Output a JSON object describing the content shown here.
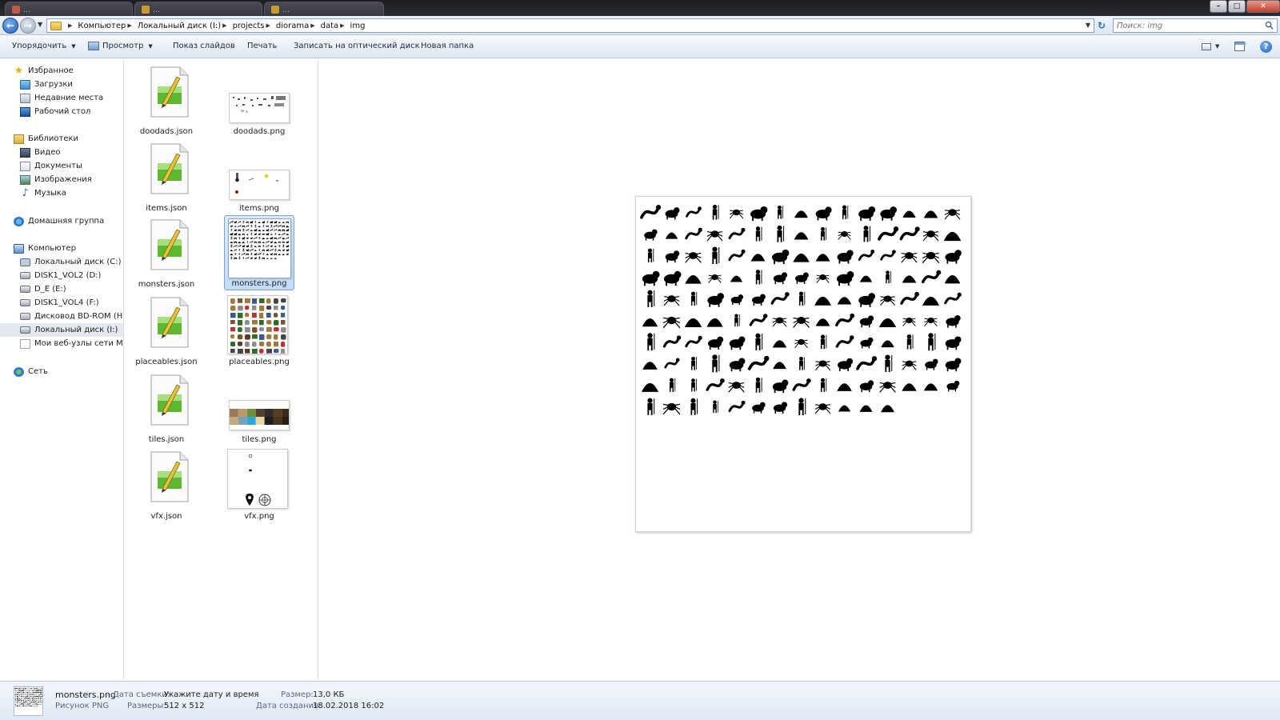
{
  "window": {
    "tabs": [
      {
        "label": "…",
        "color": "#c2574a"
      },
      {
        "label": "…",
        "color": "#c69a2e"
      },
      {
        "label": "…",
        "color": "#c69a2e"
      }
    ],
    "controls": {
      "minimize": "–",
      "maximize": "□",
      "close": "✕"
    }
  },
  "address": {
    "breadcrumbs": [
      "Компьютер",
      "Локальный диск (I:)",
      "projects",
      "diorama",
      "data",
      "img"
    ],
    "search_placeholder": "Поиск: img"
  },
  "toolbar": {
    "organize": "Упорядочить",
    "preview": "Просмотр",
    "slideshow": "Показ слайдов",
    "print": "Печать",
    "burn": "Записать на оптический диск",
    "new_folder": "Новая папка"
  },
  "nav": {
    "favorites": "Избранное",
    "downloads": "Загрузки",
    "recent": "Недавние места",
    "desktop": "Рабочий стол",
    "libraries": "Библиотеки",
    "video": "Видео",
    "documents": "Документы",
    "pictures": "Изображения",
    "music": "Музыка",
    "homegroup": "Домашняя группа",
    "computer": "Компьютер",
    "drive_c": "Локальный диск (C:)",
    "drive_d": "DISK1_VOL2 (D:)",
    "drive_e": "D_E (E:)",
    "drive_f": "DISK1_VOL4 (F:)",
    "drive_h": "Дисковод BD-ROM (H:) T",
    "drive_i": "Локальный диск (I:)",
    "msn": "Мои веб-узлы сети MSN",
    "network": "Сеть"
  },
  "files": [
    {
      "name": "doodads.json",
      "type": "json"
    },
    {
      "name": "doodads.png",
      "type": "png"
    },
    {
      "name": "items.json",
      "type": "json"
    },
    {
      "name": "items.png",
      "type": "png"
    },
    {
      "name": "monsters.json",
      "type": "json"
    },
    {
      "name": "monsters.png",
      "type": "png",
      "selected": true
    },
    {
      "name": "placeables.json",
      "type": "json"
    },
    {
      "name": "placeables.png",
      "type": "png"
    },
    {
      "name": "tiles.json",
      "type": "json"
    },
    {
      "name": "tiles.png",
      "type": "png"
    },
    {
      "name": "vfx.json",
      "type": "json"
    },
    {
      "name": "vfx.png",
      "type": "png"
    }
  ],
  "details": {
    "filename": "monsters.png",
    "filetype": "Рисунок PNG",
    "date_taken_label": "Дата съемки:",
    "date_taken_value": "Укажите дату и время",
    "dimensions_label": "Размеры:",
    "dimensions_value": "512 x 512",
    "size_label": "Размер:",
    "size_value": "13,0 КБ",
    "created_label": "Дата создания:",
    "created_value": "18.02.2018 16:02"
  },
  "colors": {
    "selection": "#c2dcfb",
    "accent": "#1f5db7",
    "sprite": "#000000"
  }
}
